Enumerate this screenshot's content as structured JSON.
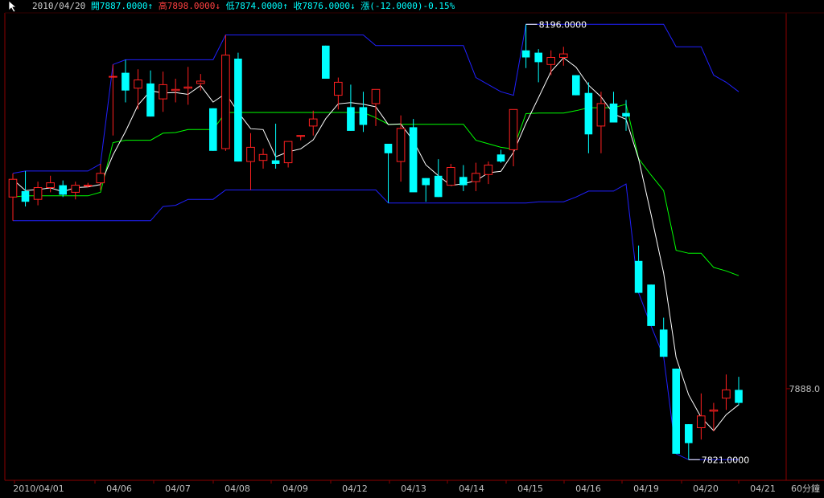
{
  "header": {
    "date": "2010/04/20",
    "open_label": "開",
    "open": "7887.0000",
    "open_arrow": "↑",
    "high_label": "高",
    "high": "7898.0000",
    "high_arrow": "↓",
    "low_label": "低",
    "low": "7874.0000",
    "low_arrow": "↑",
    "close_label": "收",
    "close": "7876.0000",
    "close_arrow": "↓",
    "change_label": "漲",
    "change": "(-12.0000)-0.15%"
  },
  "colors": {
    "background": "#000000",
    "border": "#8b0000",
    "up_candle": "#ff2020",
    "down_candle": "#00ffff",
    "blue_band": "#2020ff",
    "green_line": "#00ff00",
    "white_line": "#ffffff",
    "axis_text": "#c0c0c0",
    "cyan_text": "#00ffff",
    "red_text": "#ff4040"
  },
  "chart_data": {
    "type": "candlestick",
    "timeframe": "60分鐘",
    "x_labels": [
      "2010/04/01",
      "04/06",
      "04/07",
      "04/08",
      "04/09",
      "04/12",
      "04/13",
      "04/14",
      "04/15",
      "04/16",
      "04/19",
      "04/20",
      "04/21"
    ],
    "y_label_right": "7888.0",
    "annotations": {
      "max": "8196.0000",
      "min": "7821.0000"
    },
    "ylim": [
      7818,
      8205
    ],
    "candles": [
      [
        8050,
        8070,
        8030,
        8065
      ],
      [
        8055,
        8072,
        8042,
        8046
      ],
      [
        8048,
        8063,
        8043,
        8058
      ],
      [
        8058,
        8068,
        8054,
        8062
      ],
      [
        8060,
        8064,
        8050,
        8052
      ],
      [
        8054,
        8063,
        8048,
        8060
      ],
      [
        8060,
        8062,
        8058,
        8060
      ],
      [
        8062,
        8078,
        8056,
        8070
      ],
      [
        8152,
        8162,
        8102,
        8152
      ],
      [
        8155,
        8166,
        8130,
        8140
      ],
      [
        8142,
        8158,
        8124,
        8149
      ],
      [
        8146,
        8157,
        8118,
        8118
      ],
      [
        8133,
        8156,
        8122,
        8145
      ],
      [
        8140,
        8150,
        8130,
        8141
      ],
      [
        8142,
        8160,
        8128,
        8143
      ],
      [
        8146,
        8154,
        8140,
        8148
      ],
      [
        8125,
        8125,
        8089,
        8089
      ],
      [
        8091,
        8187,
        8089,
        8170
      ],
      [
        8167,
        8172,
        8080,
        8080
      ],
      [
        8080,
        8104,
        8056,
        8092
      ],
      [
        8081,
        8091,
        8074,
        8086
      ],
      [
        8081,
        8112,
        8074,
        8078
      ],
      [
        8079,
        8097,
        8075,
        8097
      ],
      [
        8102,
        8102,
        8098,
        8102
      ],
      [
        8110,
        8123,
        8102,
        8116
      ],
      [
        8178,
        8178,
        8150,
        8150
      ],
      [
        8136,
        8151,
        8124,
        8147
      ],
      [
        8126,
        8145,
        8106,
        8106
      ],
      [
        8126,
        8139,
        8105,
        8111
      ],
      [
        8129,
        8136,
        8110,
        8141
      ],
      [
        8095,
        8095,
        8045,
        8087
      ],
      [
        8080,
        8119,
        8063,
        8108
      ],
      [
        8109,
        8116,
        8056,
        8054
      ],
      [
        8066,
        8066,
        8046,
        8060
      ],
      [
        8068,
        8082,
        8050,
        8050
      ],
      [
        8060,
        8078,
        8062,
        8075
      ],
      [
        8067,
        8077,
        8055,
        8060
      ],
      [
        8063,
        8079,
        8055,
        8070
      ],
      [
        8069,
        8080,
        8061,
        8077
      ],
      [
        8086,
        8090,
        8079,
        8080
      ],
      [
        8090,
        8121,
        8076,
        8124
      ],
      [
        8174,
        8196,
        8159,
        8168
      ],
      [
        8172,
        8175,
        8147,
        8164
      ],
      [
        8162,
        8174,
        8153,
        8168
      ],
      [
        8168,
        8177,
        8161,
        8171
      ],
      [
        8153,
        8153,
        8136,
        8136
      ],
      [
        8138,
        8147,
        8087,
        8103
      ],
      [
        8110,
        8139,
        8087,
        8129
      ],
      [
        8129,
        8139,
        8115,
        8113
      ],
      [
        8121,
        8132,
        8106,
        8118
      ],
      [
        7996,
        8009,
        7969,
        7969
      ],
      [
        7976,
        7976,
        7941,
        7941
      ],
      [
        7938,
        7948,
        7915,
        7915
      ],
      [
        7905,
        7905,
        7833,
        7833
      ],
      [
        7858,
        7858,
        7828,
        7842
      ],
      [
        7855,
        7884,
        7845,
        7865
      ],
      [
        7869,
        7876,
        7852,
        7870
      ],
      [
        7880,
        7900,
        7870,
        7887
      ],
      [
        7887,
        7898,
        7874,
        7876
      ]
    ]
  }
}
